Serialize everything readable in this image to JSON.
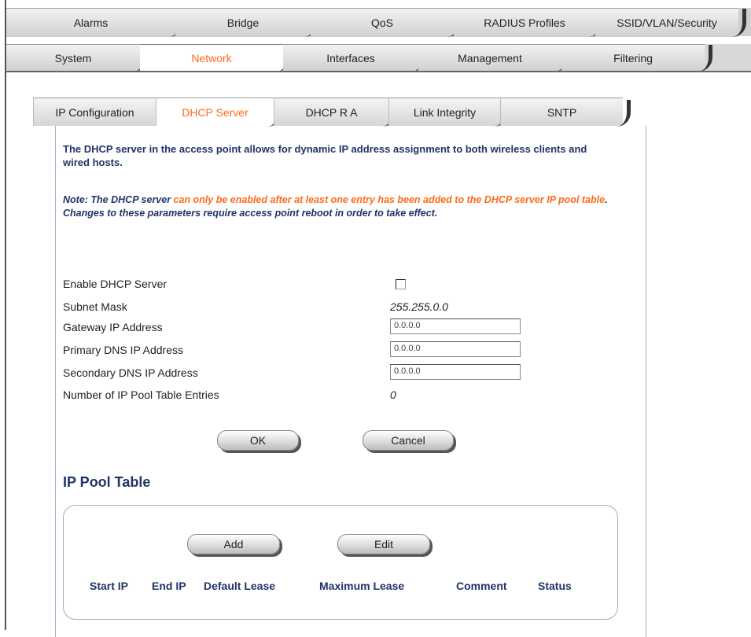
{
  "top_tabs_row1": [
    "Alarms",
    "Bridge",
    "QoS",
    "RADIUS Profiles",
    "SSID/VLAN/Security"
  ],
  "top_tabs_row2": [
    "System",
    "Network",
    "Interfaces",
    "Management",
    "Filtering"
  ],
  "top_tabs_row2_active": "Network",
  "sub_tabs": [
    "IP Configuration",
    "DHCP Server",
    "DHCP R A",
    "Link Integrity",
    "SNTP"
  ],
  "sub_tabs_active": "DHCP Server",
  "description": "The DHCP server in the access point allows for dynamic IP address assignment to both wireless clients and wired hosts.",
  "note": {
    "part1": "Note: The DHCP server ",
    "part2_highlight": "can only be enabled after at least one entry has been added to the DHCP server IP pool table",
    "part3": ". Changes to these parameters require access point reboot in order to take effect."
  },
  "fields": {
    "enable_label": "Enable DHCP Server",
    "enable_checked": false,
    "subnet_label": "Subnet Mask",
    "subnet_value": "255.255.0.0",
    "gateway_label": "Gateway IP Address",
    "gateway_value": "0.0.0.0",
    "primary_dns_label": "Primary DNS IP Address",
    "primary_dns_value": "0.0.0.0",
    "secondary_dns_label": "Secondary DNS IP Address",
    "secondary_dns_value": "0.0.0.0",
    "pool_entries_label": "Number of IP Pool Table Entries",
    "pool_entries_value": "0"
  },
  "buttons": {
    "ok": "OK",
    "cancel": "Cancel",
    "add": "Add",
    "edit": "Edit"
  },
  "pool_table": {
    "title": "IP Pool Table",
    "columns": [
      "Start IP",
      "End IP",
      "Default Lease",
      "Maximum Lease",
      "Comment",
      "Status"
    ]
  },
  "colors": {
    "active_tab": "#ff6a1a",
    "heading_blue": "#223366"
  }
}
